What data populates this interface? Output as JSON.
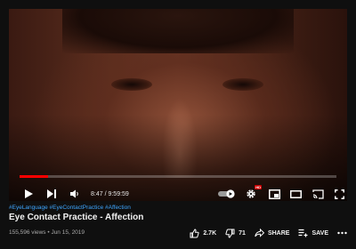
{
  "player": {
    "progress": 0.089,
    "time": {
      "current": "8:47",
      "separator": " / ",
      "duration": "9:59:59"
    },
    "autoplay_on": true,
    "accent_color": "#ff0000",
    "badge": "HD"
  },
  "video": {
    "hashtags": "#EyeLanguage #EyeContactPractice #Affection",
    "title": "Eye Contact Practice - Affection",
    "meta": "155,596 views • Jun 15, 2019"
  },
  "actions": {
    "like_count": "2.7K",
    "dislike_count": "71",
    "share_label": "SHARE",
    "save_label": "SAVE"
  },
  "icons": [
    "play-icon",
    "next-icon",
    "volume-icon",
    "autoplay-toggle",
    "settings-icon",
    "miniplayer-icon",
    "theater-icon",
    "cast-icon",
    "fullscreen-icon",
    "like-icon",
    "dislike-icon",
    "share-icon",
    "save-icon",
    "more-icon"
  ]
}
